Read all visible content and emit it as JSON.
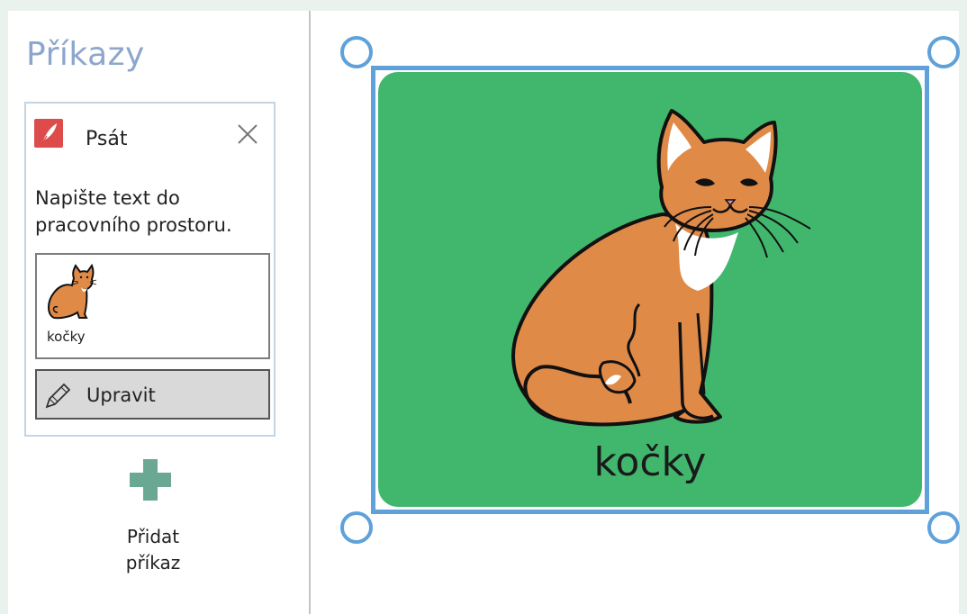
{
  "panel": {
    "title": "Příkazy",
    "command": {
      "title": "Psát",
      "description": "Napište text do pracovního prostoru.",
      "symbol_label": "kočky",
      "edit_label": "Upravit"
    },
    "add_command_label": "Přidat příkaz"
  },
  "stage": {
    "card_label": "kočky",
    "card_color": "#41b76d",
    "selection_color": "#5fa1d9"
  },
  "icons": {
    "command": "quill-icon",
    "close": "close-icon",
    "edit": "pencil-icon",
    "add": "plus-icon"
  }
}
